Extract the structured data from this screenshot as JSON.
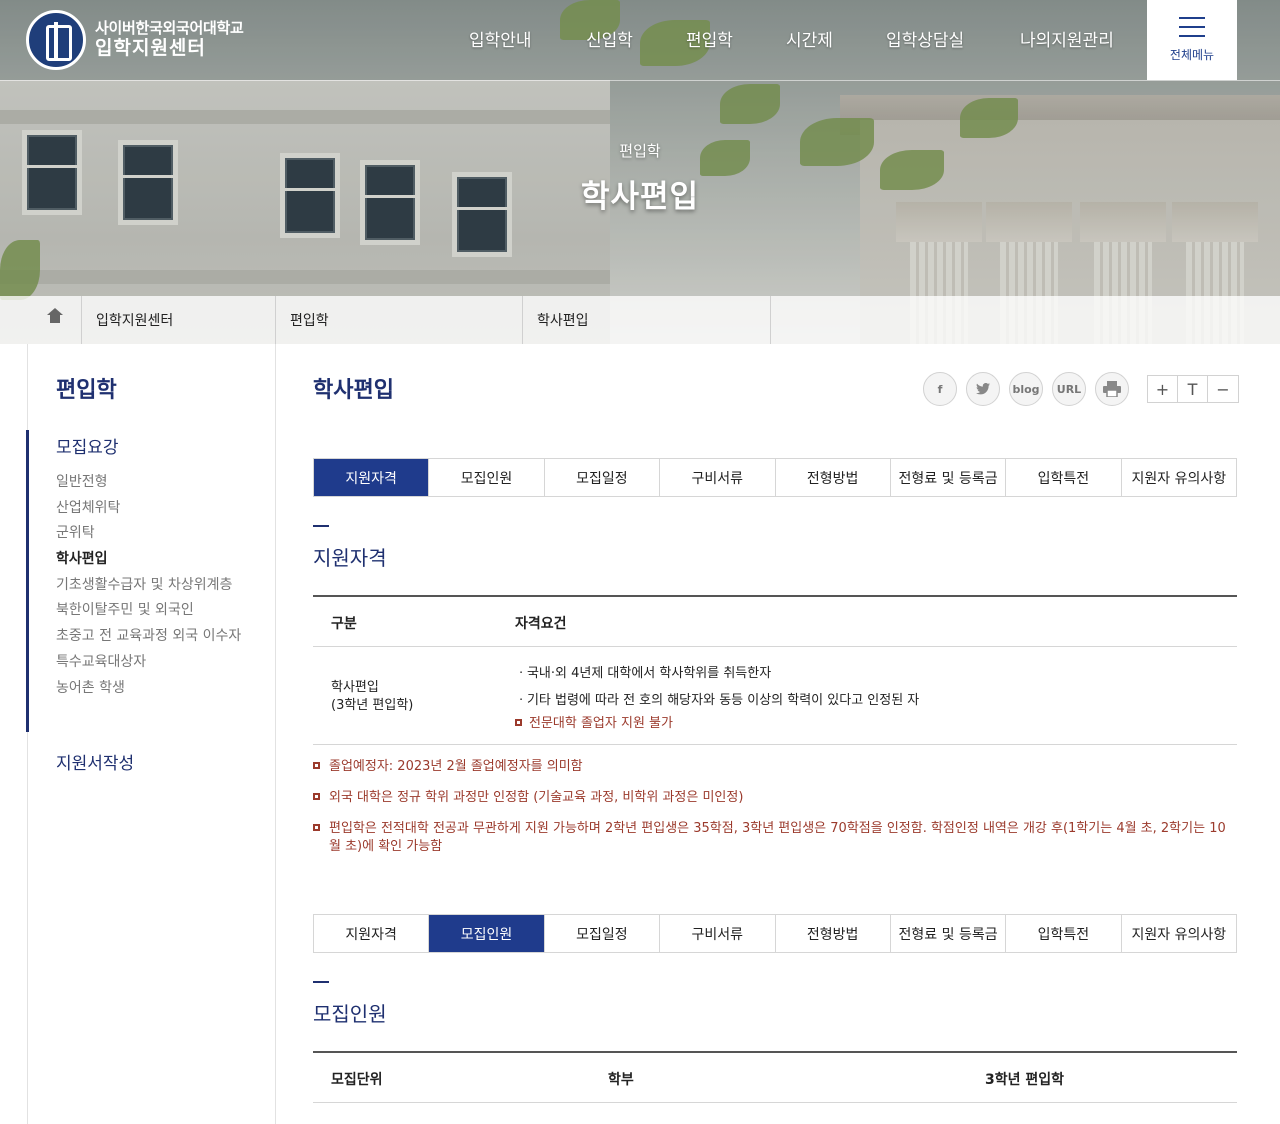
{
  "header": {
    "logo_line1": "사이버한국외국어대학교",
    "logo_line2": "입학지원센터",
    "nav": [
      "입학안내",
      "신입학",
      "편입학",
      "시간제",
      "입학상담실",
      "나의지원관리"
    ],
    "all_menu_label": "전체메뉴"
  },
  "hero": {
    "subtitle": "편입학",
    "title": "학사편입"
  },
  "breadcrumb": [
    "입학지원센터",
    "편입학",
    "학사편입"
  ],
  "sidebar": {
    "title": "편입학",
    "group1": "모집요강",
    "items": [
      {
        "label": "일반전형"
      },
      {
        "label": "산업체위탁"
      },
      {
        "label": "군위탁"
      },
      {
        "label": "학사편입",
        "active": true
      },
      {
        "label": "기초생활수급자 및 차상위계층"
      },
      {
        "label": "북한이탈주민 및 외국인"
      },
      {
        "label": "초중고 전 교육과정 외국 이수자"
      },
      {
        "label": "특수교육대상자"
      },
      {
        "label": "농어촌 학생"
      }
    ],
    "group2": "지원서작성"
  },
  "content": {
    "title": "학사편입",
    "share": [
      "f",
      "t",
      "blog",
      "URL",
      "print"
    ],
    "font_controls": [
      "+",
      "T",
      "−"
    ],
    "tabs": [
      "지원자격",
      "모집인원",
      "모집일정",
      "구비서류",
      "전형방법",
      "전형료 및 등록금",
      "입학특전",
      "지원자 유의사항"
    ],
    "section1": {
      "title": "지원자격",
      "col1": "구분",
      "col2": "자격요건",
      "row_label_line1": "학사편입",
      "row_label_line2": "(3학년 편입학)",
      "req1": "ㆍ국내·외 4년제 대학에서 학사학위를 취득한자",
      "req2": "ㆍ기타 법령에 따라 전 호의 해당자와 동등 이상의 학력이 있다고 인정된 자",
      "req3": "전문대학 졸업자 지원 불가",
      "notes": [
        "졸업예정자: 2023년 2월 졸업예정자를 의미함",
        "외국 대학은 정규 학위 과정만 인정함 (기술교육 과정, 비학위 과정은 미인정)",
        "편입학은 전적대학 전공과 무관하게 지원 가능하며 2학년 편입생은 35학점, 3학년 편입생은 70학점을 인정함. 학점인정 내역은 개강 후(1학기는 4월 초, 2학기는 10월 초)에 확인 가능함"
      ]
    },
    "section2": {
      "title": "모집인원",
      "col1": "모집단위",
      "col2": "학부",
      "col3": "3학년 편입학"
    }
  },
  "colors": {
    "primary": "#1f3b8c",
    "note_red": "#9b3a2c"
  }
}
